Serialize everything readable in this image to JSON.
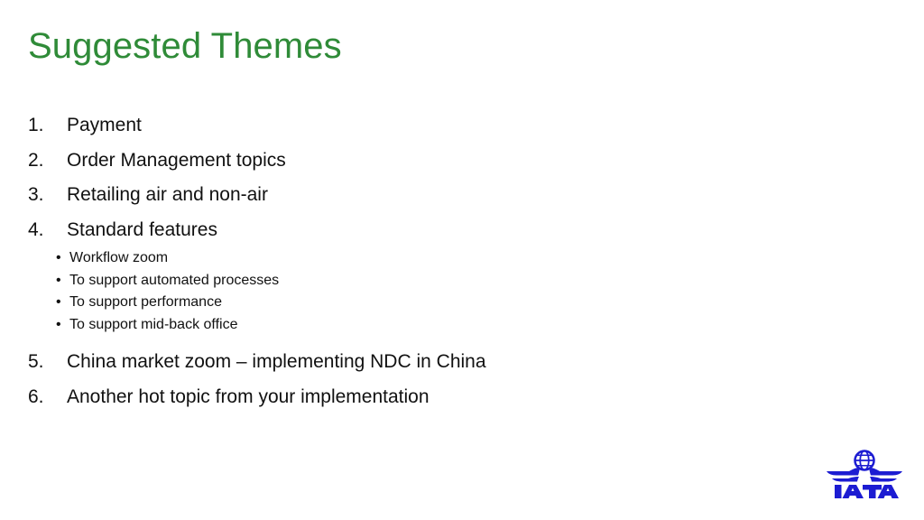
{
  "slide": {
    "title": "Suggested Themes",
    "title_color": "#2f8b38",
    "background_color": "#ffffff",
    "text_color": "#111111"
  },
  "list": {
    "items": [
      {
        "marker": "1.",
        "text": "Payment"
      },
      {
        "marker": "2.",
        "text": "Order Management topics"
      },
      {
        "marker": "3.",
        "text": "Retailing air and non-air"
      },
      {
        "marker": "4.",
        "text": "Standard features"
      },
      {
        "marker": "5.",
        "text": "China market zoom – implementing NDC in China"
      },
      {
        "marker": "6.",
        "text": "Another hot topic from your implementation"
      }
    ],
    "sub_items": [
      {
        "bullet": "•",
        "text": "Workflow zoom"
      },
      {
        "bullet": "•",
        "text": "To support automated processes"
      },
      {
        "bullet": "•",
        "text": "To support performance"
      },
      {
        "bullet": "•",
        "text": "To support mid-back office"
      }
    ]
  },
  "logo": {
    "name": "iata-logo",
    "text": "IATA",
    "color": "#1c1cd2"
  }
}
